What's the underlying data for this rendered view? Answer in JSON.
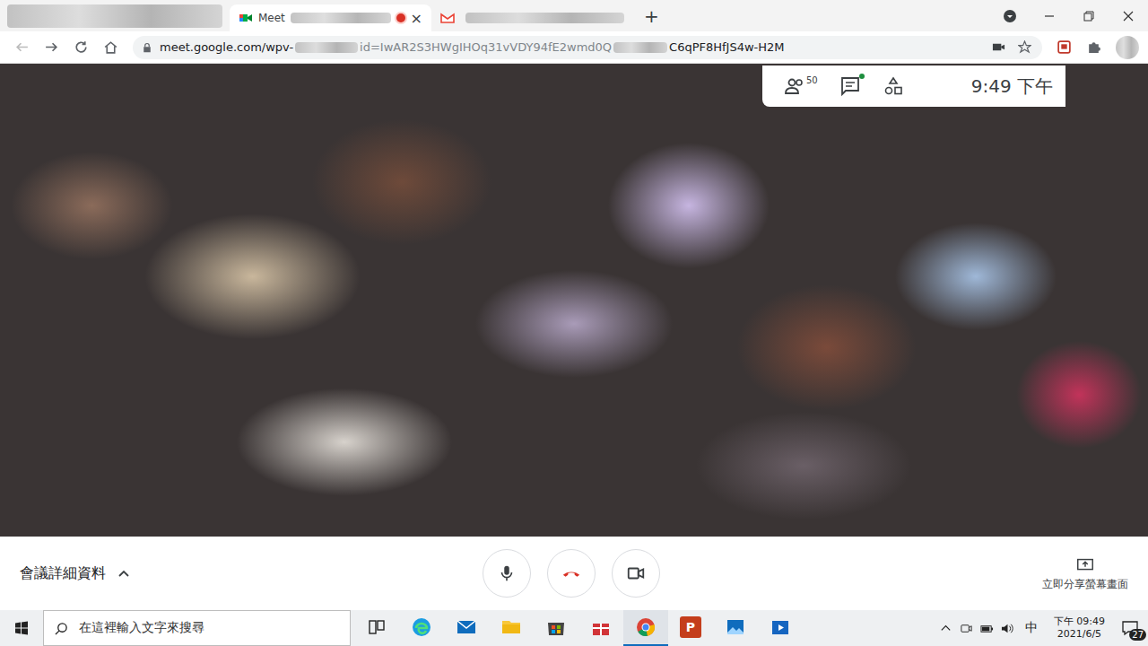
{
  "browser": {
    "tabs": [
      {
        "label": "Meet",
        "selected": true,
        "recording": true,
        "kind": "meet"
      },
      {
        "label": "",
        "selected": false,
        "recording": false,
        "kind": "gmail"
      }
    ],
    "close": "×",
    "new_tab": "+",
    "url": {
      "host": "meet.google.com/wpv-",
      "query": "id=IwAR2S3HWgIHOq31vVDY94fE2wmd0Q",
      "tail": "C6qPF8HfJS4w-H2M"
    }
  },
  "meeting": {
    "participants": "50",
    "chat_unread": true,
    "time": "9:49 下午",
    "details": "會議詳細資料",
    "present": "立即分享螢幕畫面"
  },
  "taskbar": {
    "search_placeholder": "在這裡輸入文字來搜尋",
    "apps": [
      {
        "kind": "taskview",
        "label": "",
        "selected": false
      },
      {
        "kind": "edge",
        "label": "",
        "selected": false
      },
      {
        "kind": "mail",
        "label": "",
        "selected": false
      },
      {
        "kind": "explorer",
        "label": "",
        "selected": false
      },
      {
        "kind": "store",
        "label": "",
        "selected": false
      },
      {
        "kind": "gift",
        "label": "",
        "selected": false
      },
      {
        "kind": "chrome",
        "label": "",
        "selected": true
      },
      {
        "kind": "powerpoint",
        "label": "P",
        "selected": false
      },
      {
        "kind": "photos",
        "label": "",
        "selected": false
      },
      {
        "kind": "movies",
        "label": "",
        "selected": false
      }
    ],
    "ime": "中",
    "time": "下午 09:49",
    "date": "2021/6/5",
    "notifications": "27"
  }
}
